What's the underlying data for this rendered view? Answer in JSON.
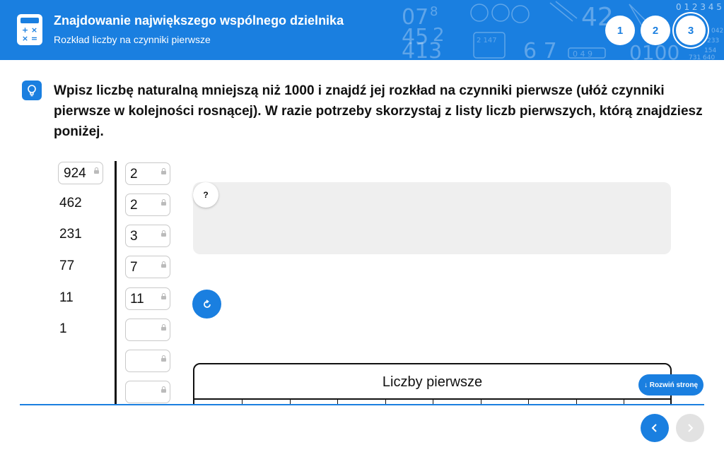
{
  "header": {
    "title": "Znajdowanie największego wspólnego dzielnika",
    "subtitle": "Rozkład liczby na czynniki pierwsze",
    "calculator_icon": "calculator-icon",
    "steps": [
      {
        "label": "1",
        "active": false
      },
      {
        "label": "2",
        "active": false
      },
      {
        "label": "3",
        "active": true
      }
    ],
    "accent_color": "#1a7fe0"
  },
  "instruction": {
    "icon": "lightbulb-icon",
    "text": "Wpisz liczbę naturalną mniejszą niż 1000 i znajdź jej rozkład na czynniki pierwsze (ułóż czynniki pierwsze w kolejności rosnącej). W razie potrzeby skorzystaj z listy liczb pierwszych, którą znajdziesz poniżej."
  },
  "factorization": {
    "input_number": "924",
    "quotients": [
      "462",
      "231",
      "77",
      "11",
      "1"
    ],
    "factors": [
      "2",
      "2",
      "3",
      "7",
      "11",
      "",
      "",
      ""
    ]
  },
  "feedback": {
    "badge": "?"
  },
  "prime_list": {
    "title": "Liczby pierwsze"
  },
  "expand_button": {
    "label": "↓ Rozwiń stronę"
  },
  "nav": {
    "prev_icon": "chevron-left-icon",
    "next_icon": "chevron-right-icon"
  }
}
